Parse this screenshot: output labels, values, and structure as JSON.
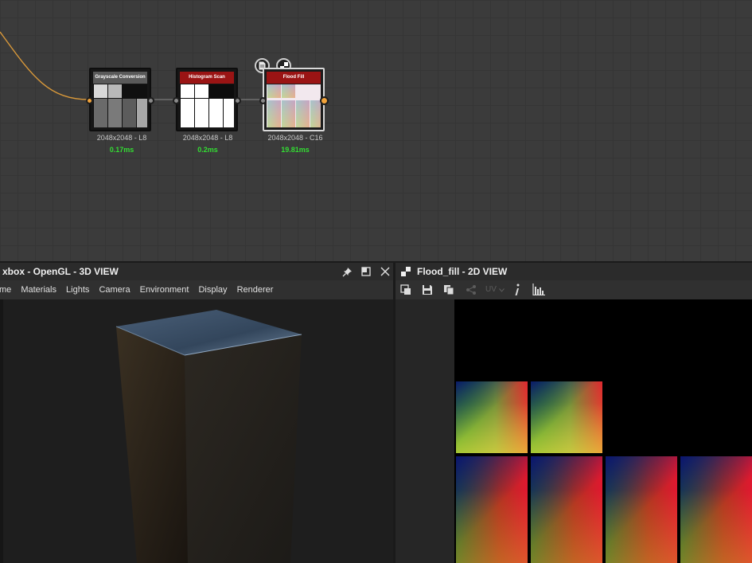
{
  "graph": {
    "nodes": [
      {
        "title": "Grayscale Conversion",
        "resolution": "2048x2048 - L8",
        "time": "0.17ms",
        "title_color": "#5a5a5a"
      },
      {
        "title": "Histogram Scan",
        "resolution": "2048x2048 - L8",
        "time": "0.2ms",
        "title_color": "#9a1414"
      },
      {
        "title": "Flood Fill",
        "resolution": "2048x2048 - C16",
        "time": "19.81ms",
        "title_color": "#9a1414"
      }
    ],
    "wire_color": "#d8983a"
  },
  "view3d": {
    "title": "xbox - OpenGL - 3D VIEW",
    "menu": [
      "me",
      "Materials",
      "Lights",
      "Camera",
      "Environment",
      "Display",
      "Renderer"
    ],
    "header_icons": [
      "pin-icon",
      "maximize-icon",
      "close-icon"
    ]
  },
  "view2d": {
    "title": "Flood_fill - 2D VIEW",
    "toolbar_icons": [
      "export-icon",
      "save-icon",
      "copy-icon",
      "share-icon",
      "uv-dropdown-icon",
      "info-icon",
      "histogram-icon"
    ],
    "uv_label": "UV"
  }
}
